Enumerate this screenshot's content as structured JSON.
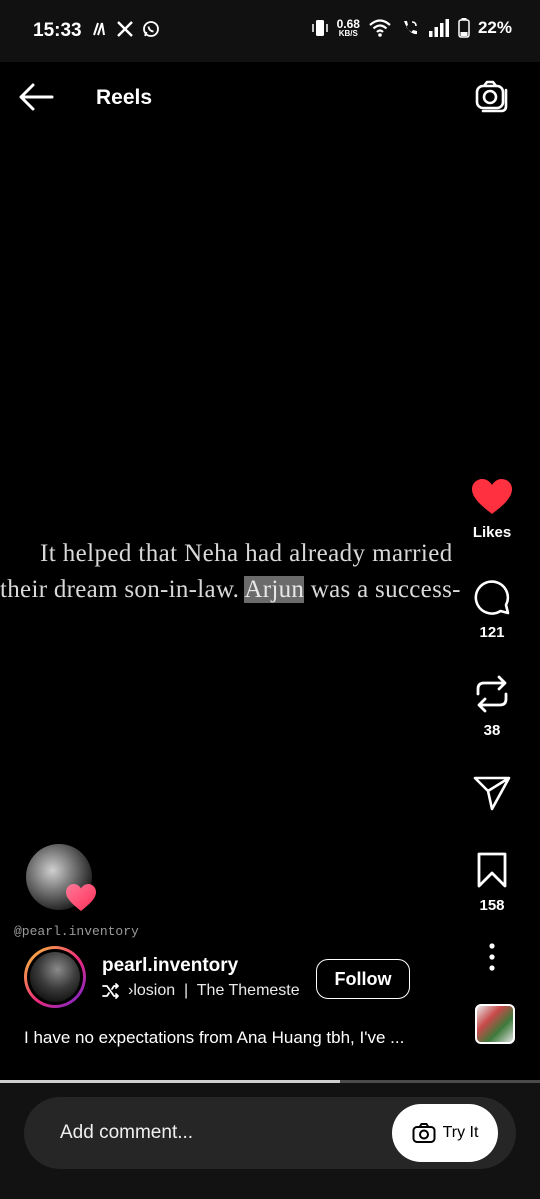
{
  "status_bar": {
    "time": "15:33",
    "net_speed_value": "0.68",
    "net_speed_unit": "KB/S",
    "battery": "22%"
  },
  "header": {
    "title": "Reels"
  },
  "reel": {
    "line1": "It helped that Neha had already married",
    "line2_before": "their dream son-in-law. ",
    "line2_highlight": "Arjun",
    "line2_after": " was a success-"
  },
  "actions": {
    "likes_label": "Likes",
    "comments_count": "121",
    "reposts_count": "38",
    "saves_count": "158"
  },
  "creator": {
    "watermark": "@pearl.inventory",
    "username": "pearl.inventory",
    "audio": "›losion  |  The Themeste",
    "follow_label": "Follow",
    "caption": "I have no expectations from Ana Huang tbh, I've ..."
  },
  "playback": {
    "progress": 0.63
  },
  "comment": {
    "placeholder": "Add comment...",
    "try_it_label": "Try It"
  },
  "colors": {
    "like": "#ff3040",
    "background": "#000000"
  }
}
